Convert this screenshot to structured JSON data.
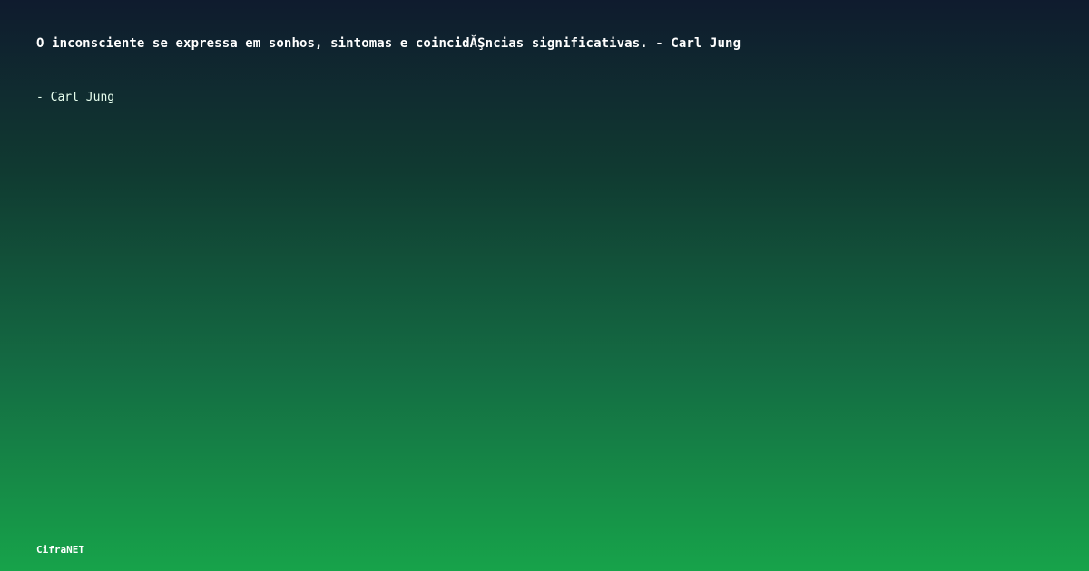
{
  "quote": {
    "text": "O inconsciente se expressa em sonhos, sintomas e coincidĂŞncias significativas. - Carl Jung",
    "author": "- Carl Jung"
  },
  "brand": {
    "name": "CifraNET"
  },
  "colors": {
    "gradient_top": "#0f1b2e",
    "gradient_mid": "#146c43",
    "gradient_bottom": "#17a34a",
    "text": "#ffffff"
  }
}
